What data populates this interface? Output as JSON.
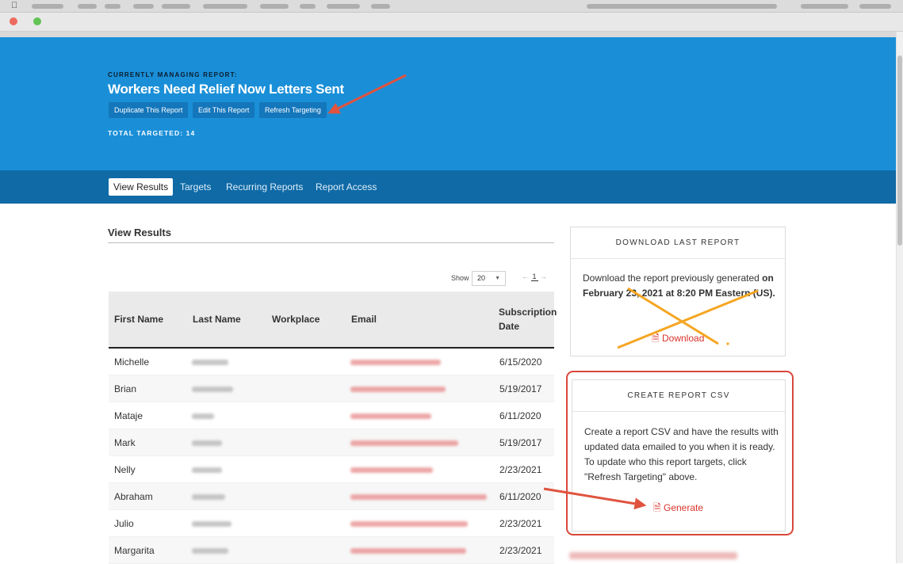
{
  "hero": {
    "eyebrow": "CURRENTLY MANAGING REPORT:",
    "title": "Workers Need Relief Now Letters Sent",
    "buttons": [
      "Duplicate This Report",
      "Edit This Report",
      "Refresh Targeting"
    ],
    "total_label": "TOTAL TARGETED: 14"
  },
  "tabs": [
    "View Results",
    "Targets",
    "Recurring Reports",
    "Report Access"
  ],
  "main": {
    "title": "View Results",
    "show_label": "Show",
    "show_value": "20",
    "page": "1",
    "columns": [
      "First Name",
      "Last Name",
      "Workplace",
      "Email",
      "Subscription Date"
    ],
    "rows": [
      {
        "first": "Michelle",
        "date": "6/15/2020"
      },
      {
        "first": "Brian",
        "date": "5/19/2017"
      },
      {
        "first": "Mataje",
        "date": "6/11/2020"
      },
      {
        "first": "Mark",
        "date": "5/19/2017"
      },
      {
        "first": "Nelly",
        "date": "2/23/2021"
      },
      {
        "first": "Abraham",
        "date": "6/11/2020"
      },
      {
        "first": "Julio",
        "date": "2/23/2021"
      },
      {
        "first": "Margarita",
        "date": "2/23/2021"
      }
    ]
  },
  "download_card": {
    "heading": "DOWNLOAD LAST REPORT",
    "text_1": "Download the report previously generated",
    "text_bold": "on February 23, 2021 at 8:20 PM Eastern (US).",
    "link": "Download"
  },
  "create_card": {
    "heading": "CREATE REPORT CSV",
    "text": "Create a report CSV and have the results with updated data emailed to you when it is ready. To update who this report targets, click \"Refresh Targeting\" above.",
    "link": "Generate"
  },
  "colors": {
    "hero_bg": "#1a8fd8",
    "tabs_bg": "#0f6aa6",
    "annotation_red": "#d9473a",
    "annotation_orange": "#f5a623"
  }
}
